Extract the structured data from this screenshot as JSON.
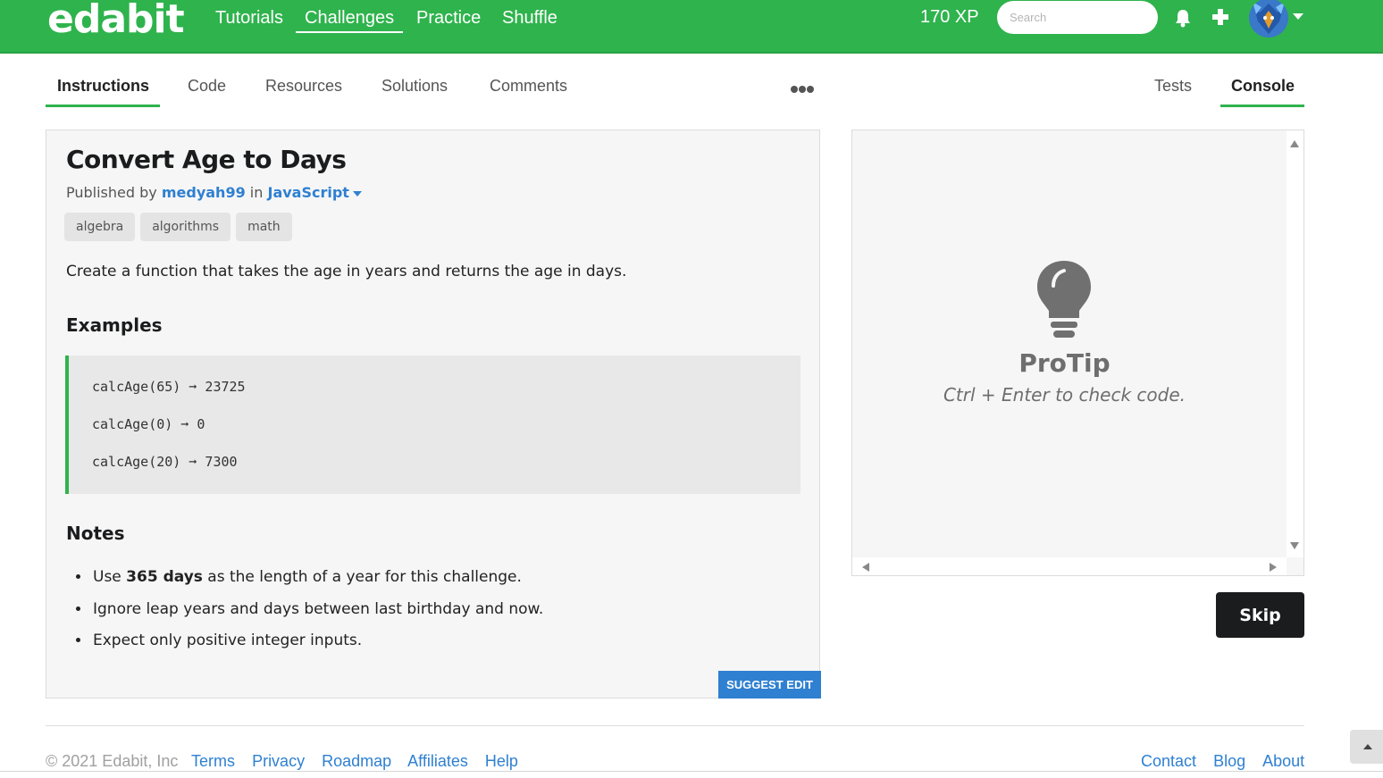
{
  "brand": {
    "logo": "edabit",
    "accent_color": "#2fb34d",
    "link_color": "#2f80d1"
  },
  "topnav": {
    "links": [
      {
        "label": "Tutorials",
        "active": false
      },
      {
        "label": "Challenges",
        "active": true
      },
      {
        "label": "Practice",
        "active": false
      },
      {
        "label": "Shuffle",
        "active": false
      }
    ],
    "xp": "170 XP",
    "search_placeholder": "Search",
    "icons": [
      "bell-icon",
      "plus-icon",
      "avatar",
      "caret-down-icon"
    ]
  },
  "tabs": {
    "left": [
      "Instructions",
      "Code",
      "Resources",
      "Solutions",
      "Comments"
    ],
    "active_left": "Instructions",
    "right": [
      "Tests",
      "Console"
    ],
    "active_right": "Console",
    "more_icon": "ellipsis-icon"
  },
  "challenge": {
    "title": "Convert Age to Days",
    "published_prefix": "Published by",
    "author": "medyah99",
    "in_word": "in",
    "language": "JavaScript",
    "tags": [
      "algebra",
      "algorithms",
      "math"
    ],
    "description": "Create a function that takes the age in years and returns the age in days.",
    "examples_heading": "Examples",
    "examples": [
      "calcAge(65) ➞ 23725",
      "calcAge(0) ➞ 0",
      "calcAge(20) ➞ 7300"
    ],
    "notes_heading": "Notes",
    "notes": [
      {
        "before": "Use ",
        "bold": "365 days",
        "after": " as the length of a year for this challenge."
      },
      {
        "before": "Ignore leap years and days between last birthday and now.",
        "bold": "",
        "after": ""
      },
      {
        "before": "Expect only positive integer inputs.",
        "bold": "",
        "after": ""
      }
    ],
    "suggest_edit": "SUGGEST EDIT"
  },
  "console": {
    "icon": "lightbulb-icon",
    "protip_title": "ProTip",
    "protip_text": "Ctrl + Enter to check code."
  },
  "skip_label": "Skip",
  "footer": {
    "copyright": "© 2021 Edabit, Inc",
    "left_links": [
      "Terms",
      "Privacy",
      "Roadmap",
      "Affiliates",
      "Help"
    ],
    "right_links": [
      "Contact",
      "Blog",
      "About"
    ]
  }
}
